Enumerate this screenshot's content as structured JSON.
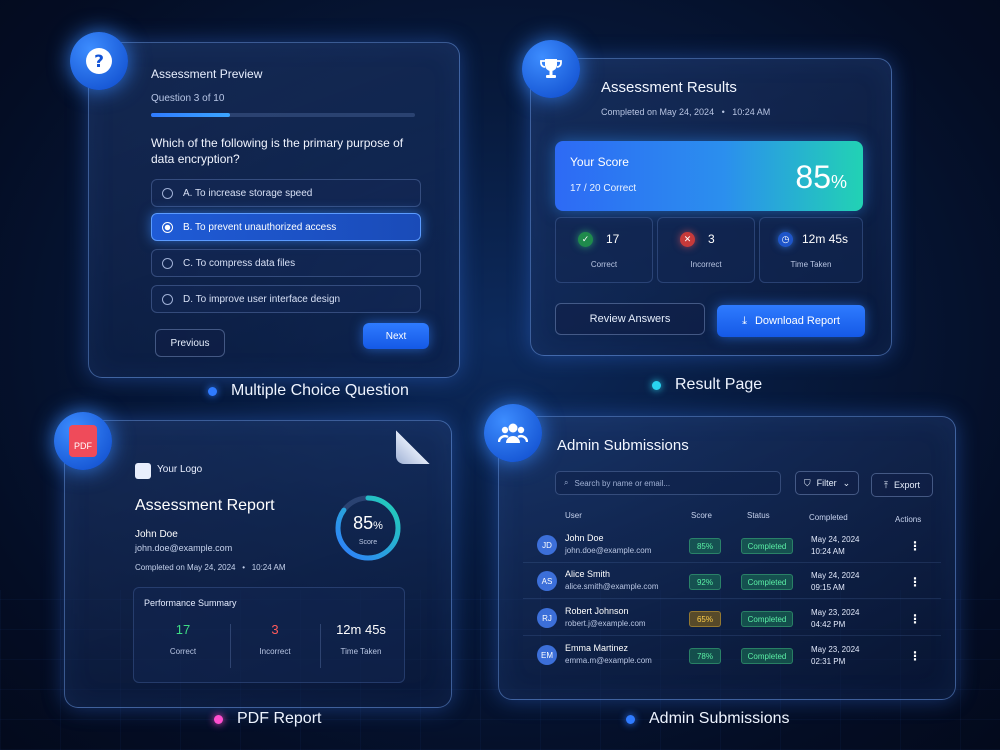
{
  "colors": {
    "accent": "#1e6bff",
    "teal": "#22d2b4",
    "success": "#3ddc84",
    "danger": "#ff5a5a",
    "amber": "#ffcf4a"
  },
  "mcq": {
    "title": "Assessment Preview",
    "question_count": "Question 3 of 10",
    "progress": 0.3,
    "question": "Which of the following is the primary purpose of data encryption?",
    "options": [
      {
        "label": "A. To increase storage speed",
        "selected": false
      },
      {
        "label": "B. To prevent unauthorized access",
        "selected": true
      },
      {
        "label": "C. To compress data files",
        "selected": false
      },
      {
        "label": "D. To improve user interface design",
        "selected": false
      }
    ],
    "previous_label": "Previous",
    "next_label": "Next",
    "caption": "Multiple Choice Question",
    "icon": "question-mark-icon"
  },
  "results": {
    "title": "Assessment Results",
    "completed": "Completed on May 24, 2024",
    "time": "10:24 AM",
    "score_label": "Your Score",
    "correct_summary": "17 / 20 Correct",
    "score_value": "85",
    "score_unit": "%",
    "stats": [
      {
        "value": "17",
        "label": "Correct",
        "icon": "check-icon"
      },
      {
        "value": "3",
        "label": "Incorrect",
        "icon": "x-icon"
      },
      {
        "value": "12m 45s",
        "label": "Time Taken",
        "icon": "clock-icon"
      }
    ],
    "review_label": "Review Answers",
    "download_label": "Download Report",
    "caption": "Result Page",
    "icon": "trophy-icon"
  },
  "pdf": {
    "badge_text": "PDF",
    "logo_text": "Your Logo",
    "title": "Assessment Report",
    "name": "John Doe",
    "email": "john.doe@example.com",
    "completed": "Completed on May 24, 2024",
    "time": "10:24 AM",
    "score_value": "85",
    "score_unit": "%",
    "score_label": "Score",
    "score_fraction": 0.85,
    "summary_title": "Performance Summary",
    "summary": [
      {
        "value": "17",
        "label": "Correct"
      },
      {
        "value": "3",
        "label": "Incorrect"
      },
      {
        "value": "12m 45s",
        "label": "Time Taken"
      }
    ],
    "caption": "PDF Report"
  },
  "admin": {
    "title": "Admin Submissions",
    "search_placeholder": "Search by name or email...",
    "filter_label": "Filter",
    "export_label": "Export",
    "columns": [
      "User",
      "Score",
      "Status",
      "Completed",
      "Actions"
    ],
    "rows": [
      {
        "initials": "JD",
        "name": "John Doe",
        "email": "john.doe@example.com",
        "score": "85%",
        "score_tone": "green",
        "status": "Completed",
        "date": "May 24, 2024",
        "time": "10:24 AM"
      },
      {
        "initials": "AS",
        "name": "Alice Smith",
        "email": "alice.smith@example.com",
        "score": "92%",
        "score_tone": "green",
        "status": "Completed",
        "date": "May 24, 2024",
        "time": "09:15 AM"
      },
      {
        "initials": "RJ",
        "name": "Robert Johnson",
        "email": "robert.j@example.com",
        "score": "65%",
        "score_tone": "amber",
        "status": "Completed",
        "date": "May 23, 2024",
        "time": "04:42 PM"
      },
      {
        "initials": "EM",
        "name": "Emma Martinez",
        "email": "emma.m@example.com",
        "score": "78%",
        "score_tone": "green",
        "status": "Completed",
        "date": "May 23, 2024",
        "time": "02:31 PM"
      }
    ],
    "caption": "Admin Submissions",
    "icon": "users-icon"
  }
}
